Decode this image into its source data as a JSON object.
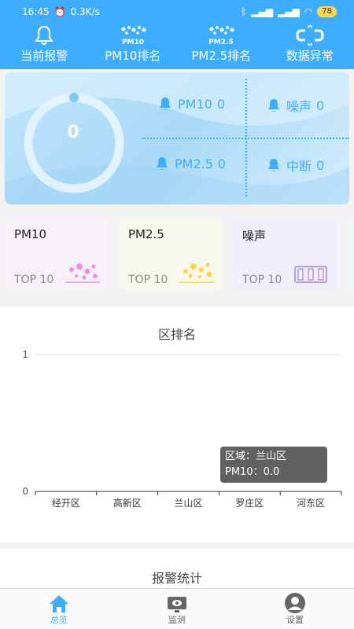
{
  "status": {
    "time": "16:45",
    "speed": "0.3K/s",
    "battery": "78"
  },
  "nav": [
    {
      "label": "当前报警",
      "icon": "bell-icon"
    },
    {
      "label": "PM10排名",
      "icon": "pm10-icon",
      "icon_text": "PM10"
    },
    {
      "label": "PM2.5排名",
      "icon": "pm25-icon",
      "icon_text": "PM2.5"
    },
    {
      "label": "数据异常",
      "icon": "broken-link-icon"
    }
  ],
  "summary": {
    "total": "0",
    "stats": [
      {
        "label": "PM10",
        "value": "0"
      },
      {
        "label": "噪声",
        "value": "0"
      },
      {
        "label": "PM2.5",
        "value": "0"
      },
      {
        "label": "中断",
        "value": "0"
      }
    ]
  },
  "categories": [
    {
      "title": "PM10",
      "sub": "TOP 10",
      "bg": "#f8f0f7",
      "accent": "#f08ee0"
    },
    {
      "title": "PM2.5",
      "sub": "TOP 10",
      "bg": "#f8f7ec",
      "accent": "#f6d64a"
    },
    {
      "title": "噪声",
      "sub": "TOP 10",
      "bg": "#efeff9",
      "accent": "#b79be6"
    }
  ],
  "ranking": {
    "title": "区排名",
    "tooltip": {
      "line1": "区域：兰山区",
      "line2": "PM10：0.0"
    }
  },
  "chart_data": {
    "type": "bar",
    "categories": [
      "经开区",
      "高新区",
      "兰山区",
      "罗庄区",
      "河东区"
    ],
    "values": [
      0,
      0,
      0,
      0,
      0
    ],
    "ylim": [
      0,
      1
    ],
    "yticks": [
      "0",
      "1"
    ],
    "grid": true
  },
  "alarm_stats": {
    "title": "报警统计"
  },
  "tabs": [
    {
      "label": "总览",
      "icon": "home-icon",
      "active": true
    },
    {
      "label": "监测",
      "icon": "monitor-icon",
      "active": false
    },
    {
      "label": "设置",
      "icon": "user-icon",
      "active": false
    }
  ],
  "colors": {
    "primary": "#3daeff"
  }
}
